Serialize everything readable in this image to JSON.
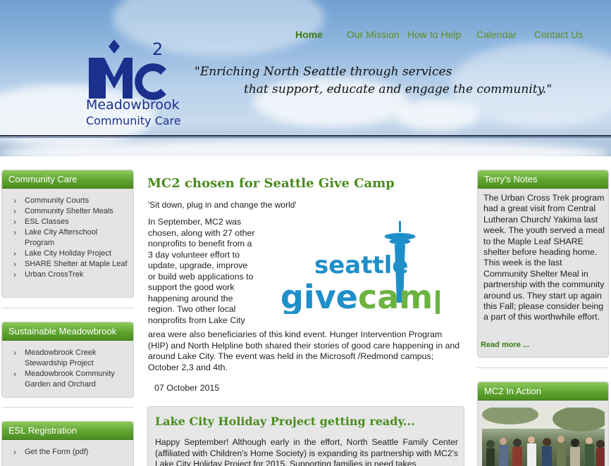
{
  "nav": {
    "items": [
      {
        "label": "Home",
        "active": true
      },
      {
        "label": "Our Mission",
        "active": false
      },
      {
        "label": "How to Help",
        "active": false
      },
      {
        "label": "Calendar",
        "active": false
      },
      {
        "label": "Contact Us",
        "active": false
      }
    ]
  },
  "logo": {
    "mark": "MC",
    "superscript": "2",
    "line1": "Meadowbrook",
    "line2": "Community Care"
  },
  "tagline": {
    "line1": "\"Enriching North Seattle through services",
    "line2": "that support, educate and engage the community.\""
  },
  "left_sidebar": {
    "community_care": {
      "title": "Community Care",
      "items": [
        "Community Courts",
        "Community Shelter Meals",
        "ESL Classes",
        "Lake City Afterschool Program",
        "Lake City Holiday Project",
        "SHARE Shelter at Maple Leaf",
        "Urban CrossTrek"
      ]
    },
    "sustainable": {
      "title": "Sustainable Meadowbrook",
      "items": [
        "Meadowbrook Creek Stewardship Project",
        "Meadowbrook Community Garden and Orchard"
      ]
    },
    "esl": {
      "title": "ESL Registration",
      "items": [
        "Get the Form (pdf)"
      ]
    }
  },
  "main": {
    "post1": {
      "title": "MC2 chosen for Seattle Give Camp",
      "lead": "'Sit down, plug in and change the world'",
      "body_wrap": [
        "In September, MC2 was",
        "chosen, along with 27 other",
        "nonprofits to benefit from a",
        "3 day volunteer effort to",
        "update, upgrade, improve",
        "or build web applications to",
        "support the good work",
        "happening around the",
        "region. Two other local",
        "nonprofits from Lake City"
      ],
      "body_full": "area were also beneficiaries of this kind event. Hunger Intervention Program (HIP) and North Helpline both shared their stories of good care happening in and around Lake City. The event was held in the Microsoft /Redmond campus; October 2,3 and 4th.",
      "date": "07 October 2015",
      "image": {
        "line1": "seattle",
        "line2a": "give",
        "line2b": "camp"
      }
    },
    "post2": {
      "title": "Lake City Holiday Project getting ready...",
      "body": "Happy September! Although early in the effort, North Seattle Family Center (affiliated with Children's Home Society) is expanding its partnership with MC2's Lake City Holiday Project for 2015. Supporting families in need takes"
    }
  },
  "right_sidebar": {
    "notes": {
      "title": "Terry's Notes",
      "body": "The Urban Cross Trek program had a great visit from Central Lutheran Church/ Yakima last week.  The youth served a meal to the Maple Leaf SHARE shelter before heading home. This week is the last Community Shelter Meal in partnership with the community around us.  They start up again this Fall; please consider being a part of this worthwhile effort.",
      "read_more": "Read more ..."
    },
    "in_action": {
      "title": "MC2 In Action"
    }
  },
  "colors": {
    "accent_green": "#4a8b1c",
    "nav_green": "#5c8f1f",
    "logo_navy": "#1b2f8c",
    "givecamp_blue": "#1f8fc9",
    "givecamp_green": "#6cb33f"
  }
}
